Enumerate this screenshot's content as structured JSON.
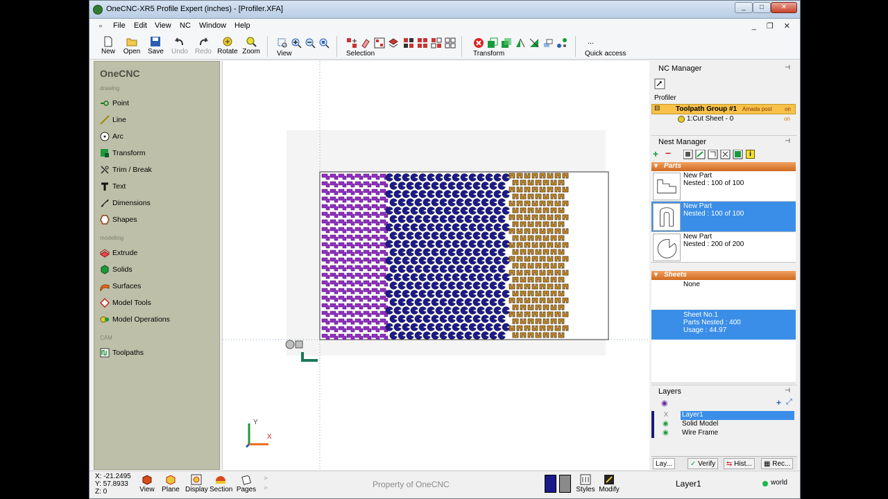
{
  "window": {
    "title": "OneCNC-XR5 Profile Expert (inches) - [Profiler.XFA]",
    "min": "_",
    "max": "□",
    "close": "✕"
  },
  "menu": {
    "items": [
      "File",
      "Edit",
      "View",
      "NC",
      "Window",
      "Help"
    ],
    "mdi": "_ ❐ ✕",
    "doc_icon": "▫"
  },
  "toolbar": {
    "new": "New",
    "open": "Open",
    "save": "Save",
    "undo": "Undo",
    "redo": "Redo",
    "rotate": "Rotate",
    "zoom": "Zoom",
    "view": "View",
    "selection": "Selection",
    "transform": "Transform",
    "quick_access": "Quick access",
    "more": "..."
  },
  "left": {
    "title": "OneCNC",
    "sections": {
      "drawing": "drawing",
      "modelling": "modelling",
      "cam": "CAM"
    },
    "drawing": [
      "Point",
      "Line",
      "Arc",
      "Transform",
      "Trim / Break",
      "Text",
      "Dimensions",
      "Shapes"
    ],
    "modelling": [
      "Extrude",
      "Solids",
      "Surfaces",
      "Model Tools",
      "Model Operations"
    ],
    "cam": [
      "Toolpaths"
    ]
  },
  "canvas": {
    "axis_y": "Y",
    "axis_x": "X"
  },
  "nc_manager": {
    "title": "NC Manager",
    "pin": "⊣",
    "profiler": "Profiler",
    "group": {
      "expander": "⊟",
      "name": "Toolpath Group #1",
      "post": "Amada post",
      "state": "on"
    },
    "child": {
      "name": "1:Cut Sheet - 0",
      "state": "on"
    }
  },
  "nest_manager": {
    "title": "Nest Manager",
    "pin": "⊣",
    "add": "+",
    "remove": "−",
    "info": "i",
    "parts_header": "Parts",
    "parts": [
      {
        "name": "New Part",
        "nested": "Nested : 100 of 100"
      },
      {
        "name": "New Part",
        "nested": "Nested : 100 of 100"
      },
      {
        "name": "New Part",
        "nested": "Nested : 200 of 200"
      }
    ],
    "sheets_header": "Sheets",
    "sheet_none": "None",
    "sheet": {
      "name": "Sheet No.1",
      "parts": "Parts Nested : 400",
      "usage": "Usage : 44.97"
    }
  },
  "layers": {
    "title": "Layers",
    "pin": "⊣",
    "rows": [
      {
        "name": "Layer1",
        "state": "X"
      },
      {
        "name": "Solid Model",
        "state": "◉"
      },
      {
        "name": "Wire Frame",
        "state": "◉"
      }
    ]
  },
  "tabs": [
    "Lay...",
    "Verify",
    "Hist...",
    "Rec..."
  ],
  "status": {
    "x": "X: -21.2495",
    "y": "Y: 57.8933",
    "z": "Z: 0",
    "view": "View",
    "plane": "Plane",
    "display": "Display",
    "section": "Section",
    "pages": "Pages",
    "property": "Property of OneCNC",
    "styles": "Styles",
    "modify": "Modify",
    "layer": "Layer1",
    "world": "world"
  },
  "colors": {
    "purple": "#8f2fc0",
    "blue": "#1c1a8c",
    "tan": "#c8902a",
    "selection": "#3b8ee8",
    "panel": "#bdbfa8"
  }
}
